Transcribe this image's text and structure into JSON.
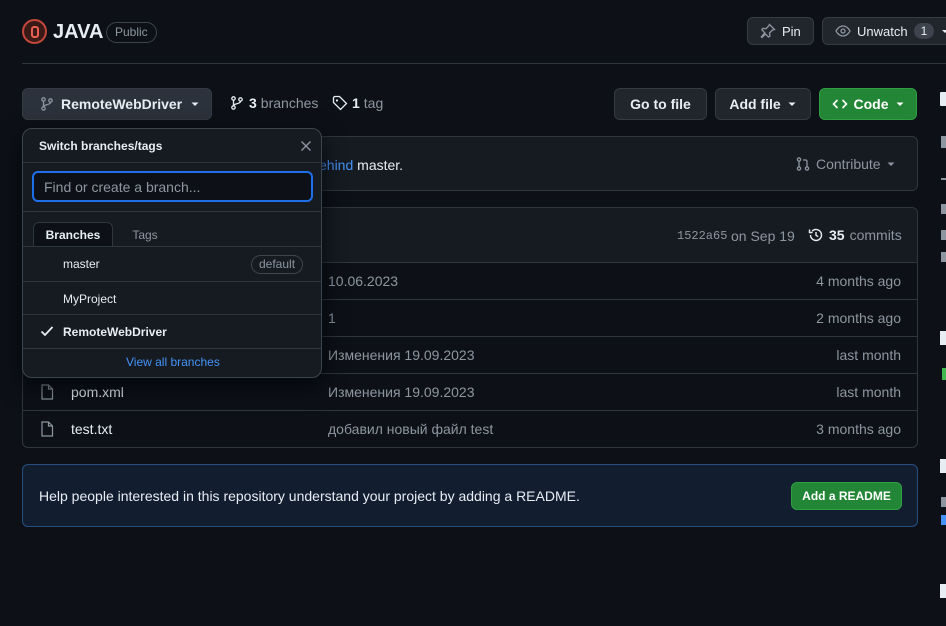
{
  "repo": {
    "name": "JAVA",
    "visibility": "Public"
  },
  "actions": {
    "pin": "Pin",
    "unwatch": "Unwatch",
    "watch_count": "1"
  },
  "toolbar": {
    "branch": "RemoteWebDriver",
    "branches_count": "3",
    "branches_label": "branches",
    "tags_count": "1",
    "tags_label": "tag",
    "go_to_file": "Go to file",
    "add_file": "Add file",
    "code": "Code"
  },
  "behind": {
    "link": "ehind",
    "rest": "master.",
    "contribute": "Contribute"
  },
  "commit": {
    "hash": "1522a65",
    "date": "on Sep 19",
    "count": "35",
    "label": "commits"
  },
  "files": [
    {
      "name": "",
      "message": "10.06.2023",
      "age": "4 months ago"
    },
    {
      "name": "",
      "message": "1",
      "age": "2 months ago"
    },
    {
      "name": "",
      "message": "Изменения 19.09.2023",
      "age": "last month"
    },
    {
      "name": "pom.xml",
      "message": "Изменения 19.09.2023",
      "age": "last month"
    },
    {
      "name": "test.txt",
      "message": "добавил новый файл test",
      "age": "3 months ago"
    }
  ],
  "readme": {
    "text": "Help people interested in this repository understand your project by adding a README.",
    "button": "Add a README"
  },
  "dropdown": {
    "title": "Switch branches/tags",
    "placeholder": "Find or create a branch...",
    "tabs": [
      "Branches",
      "Tags"
    ],
    "branches": [
      {
        "name": "master",
        "badge": "default",
        "selected": false
      },
      {
        "name": "MyProject",
        "badge": "",
        "selected": false
      },
      {
        "name": "RemoteWebDriver",
        "badge": "",
        "selected": true
      }
    ],
    "view_all": "View all branches"
  },
  "colors": {
    "bg": "#0d1117",
    "border": "#30363d",
    "accent": "#4493f8",
    "green": "#238636"
  }
}
